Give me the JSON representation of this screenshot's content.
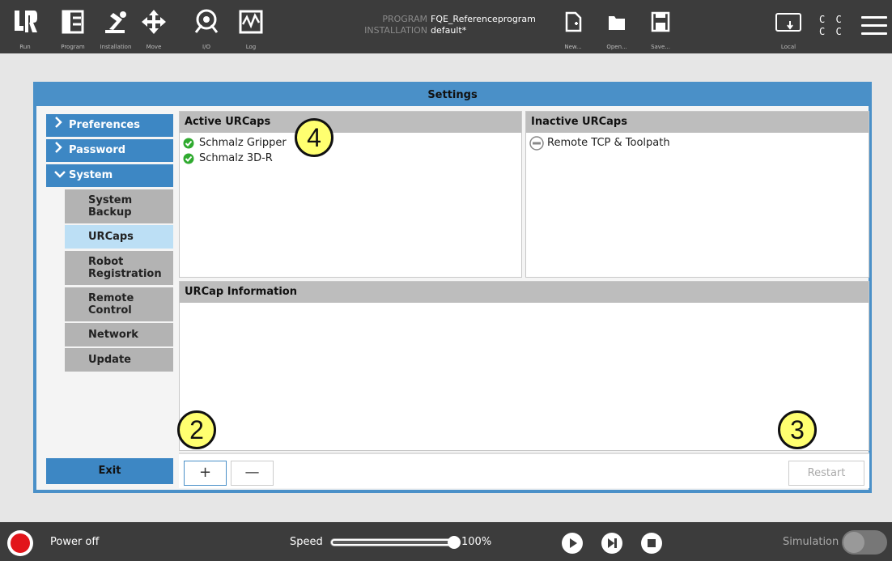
{
  "topbar": {
    "nav": [
      {
        "label": "Run",
        "icon": "ur-logo-icon"
      },
      {
        "label": "Program",
        "icon": "program-icon"
      },
      {
        "label": "Installation",
        "icon": "installation-icon"
      },
      {
        "label": "Move",
        "icon": "move-icon"
      },
      {
        "label": "I/O",
        "icon": "io-icon"
      },
      {
        "label": "Log",
        "icon": "log-icon"
      }
    ],
    "program_key": "PROGRAM",
    "program_value": "FQE_Referenceprogram",
    "installation_key": "INSTALLATION",
    "installation_value": "default*",
    "file": [
      {
        "label": "New...",
        "icon": "new-file-icon"
      },
      {
        "label": "Open...",
        "icon": "folder-icon"
      },
      {
        "label": "Save...",
        "icon": "save-icon"
      }
    ],
    "local_label": "Local",
    "cc_line1": "C C",
    "cc_line2": "C C"
  },
  "dialog": {
    "title": "Settings",
    "nav": {
      "preferences": "Preferences",
      "password": "Password",
      "system": "System"
    },
    "sub": {
      "system_backup": "System Backup",
      "urcaps": "URCaps",
      "robot_registration": "Robot Registration",
      "remote_control": "Remote Control",
      "network": "Network",
      "update": "Update"
    },
    "exit_label": "Exit",
    "active_header": "Active URCaps",
    "active_items": [
      "Schmalz Gripper",
      "Schmalz 3D-R"
    ],
    "inactive_header": "Inactive URCaps",
    "inactive_items": [
      "Remote TCP & Toolpath"
    ],
    "info_header": "URCap Information",
    "add_label": "+",
    "remove_label": "—",
    "restart_label": "Restart"
  },
  "callouts": [
    "4",
    "2",
    "3"
  ],
  "bottombar": {
    "power_label": "Power off",
    "speed_label": "Speed",
    "speed_value": "100%",
    "speed_fraction": 1.0,
    "simulation_label": "Simulation"
  },
  "colors": {
    "accent": "#4a90c8",
    "topbar": "#3c3c3c",
    "power_off": "#e2151b",
    "active_check": "#2faa2f",
    "callout": "#ffff70"
  }
}
